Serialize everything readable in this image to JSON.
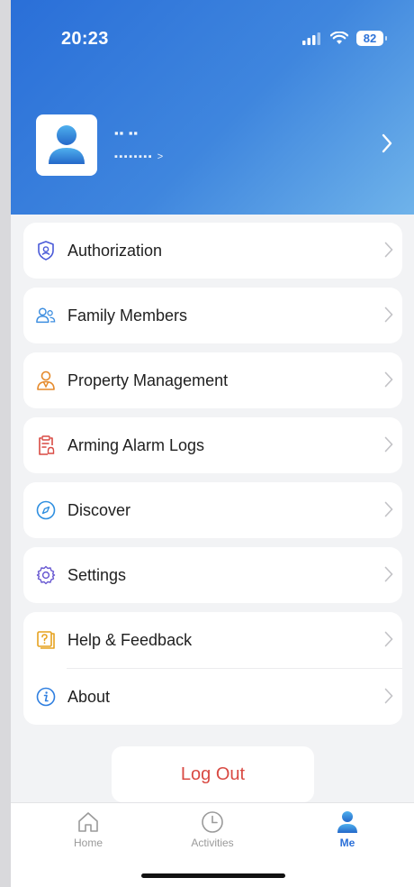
{
  "status_bar": {
    "time": "20:23",
    "battery": "82"
  },
  "profile": {
    "name": "▪︎▪︎ ▪︎▪︎",
    "subtitle": "▪︎▪︎▪︎▪︎▪︎▪︎▪︎▪︎ >"
  },
  "menu": {
    "authorization": "Authorization",
    "family_members": "Family Members",
    "property_management": "Property Management",
    "arming_alarm_logs": "Arming Alarm Logs",
    "discover": "Discover",
    "settings": "Settings",
    "help_feedback": "Help & Feedback",
    "about": "About"
  },
  "logout_label": "Log Out",
  "tabs": {
    "home": "Home",
    "activities": "Activities",
    "me": "Me"
  },
  "colors": {
    "accent": "#2a6fd8",
    "logout": "#d94a43"
  }
}
